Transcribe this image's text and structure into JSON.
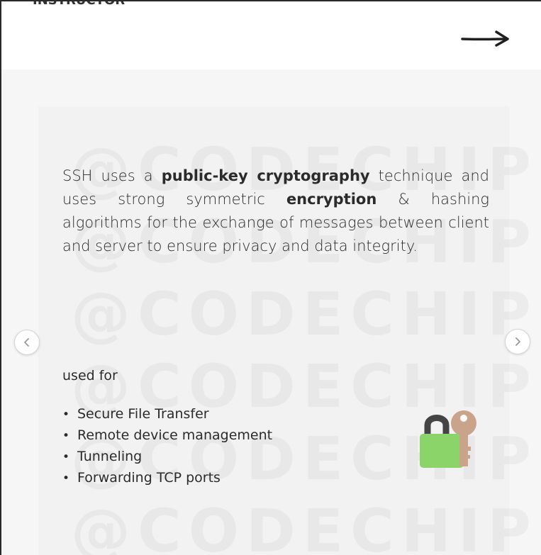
{
  "header": {
    "cutoff_text": "INSTRUCTOR",
    "next_arrow_icon": "arrow-right-icon"
  },
  "watermark": {
    "text": "@CODECHIPS"
  },
  "description": {
    "part1": "SSH uses a ",
    "bold1": "public-key cryptography",
    "part2": " technique and uses strong symmetric ",
    "bold2": "encryption",
    "part3": " & hashing algorithms for the exchange of messages between client and server to ensure privacy and data integrity."
  },
  "uses": {
    "heading": "used for",
    "items": [
      "Secure File Transfer",
      "Remote device management",
      "Tunneling",
      "Forwarding TCP ports"
    ],
    "bullet": "•"
  },
  "navigation": {
    "prev_icon": "chevron-left-icon",
    "next_icon": "chevron-right-icon"
  },
  "illustration": {
    "icon": "padlock-key-icon",
    "lock_color": "#8bd46a",
    "shackle_color": "#444444",
    "key_color": "#c9a48a"
  }
}
